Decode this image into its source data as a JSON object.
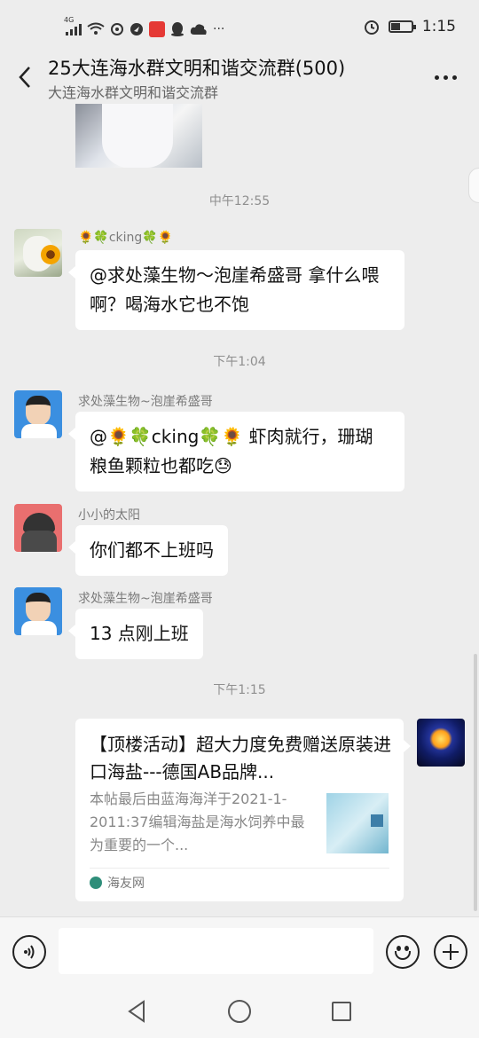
{
  "status_bar": {
    "network": "4G",
    "time": "1:15",
    "more": "···"
  },
  "header": {
    "title": "25大连海水群文明和谐交流群(500)",
    "subtitle": "大连海水群文明和谐交流群"
  },
  "messages": {
    "ts1": "中午12:55",
    "m1": {
      "sender": "🌻🍀cking🍀🌻",
      "text": "@求处藻生物～泡崖希盛哥  拿什么喂啊？喝海水它也不饱"
    },
    "ts2": "下午1:04",
    "m2": {
      "sender": "求处藻生物~泡崖希盛哥",
      "text": "@🌻🍀cking🍀🌻  虾肉就行，珊瑚粮鱼颗粒也都吃😓"
    },
    "m3": {
      "sender": "小小的太阳",
      "text": "你们都不上班吗"
    },
    "m4": {
      "sender": "求处藻生物~泡崖希盛哥",
      "text": "13 点刚上班"
    },
    "ts3": "下午1:15",
    "card": {
      "title": "【顶楼活动】超大力度免费赠送原装进口海盐---德国AB品牌...",
      "description": "本帖最后由蓝海海洋于2021-1-2011:37编辑海盐是海水饲养中最为重要的一个...",
      "source": "海友网"
    }
  },
  "input": {
    "placeholder": ""
  }
}
